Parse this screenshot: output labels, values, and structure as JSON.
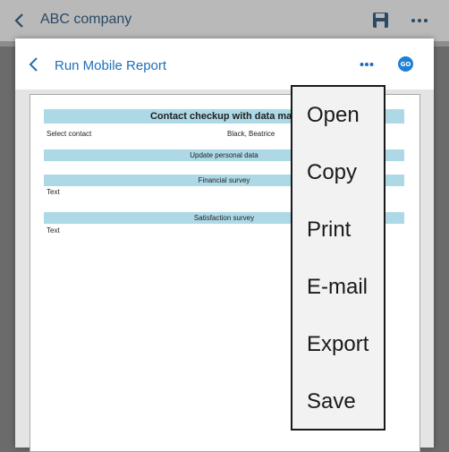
{
  "app": {
    "title": "ABC company"
  },
  "modal": {
    "title": "Run Mobile Report",
    "go_label": "GO"
  },
  "report": {
    "title": "Contact checkup with data map",
    "select_contact_label": "Select contact",
    "select_contact_value": "Black, Beatrice",
    "sections": [
      {
        "title": "Update personal data",
        "field": ""
      },
      {
        "title": "Financial survey",
        "field": "Text"
      },
      {
        "title": "Satisfaction survey",
        "field": "Text"
      }
    ]
  },
  "menu": {
    "items": [
      {
        "label": "Open"
      },
      {
        "label": "Copy"
      },
      {
        "label": "Print"
      },
      {
        "label": "E-mail"
      },
      {
        "label": "Export"
      },
      {
        "label": "Save"
      }
    ]
  },
  "colors": {
    "accent": "#1f6fb8",
    "band": "#add8e6",
    "go": "#1e7fd6"
  }
}
